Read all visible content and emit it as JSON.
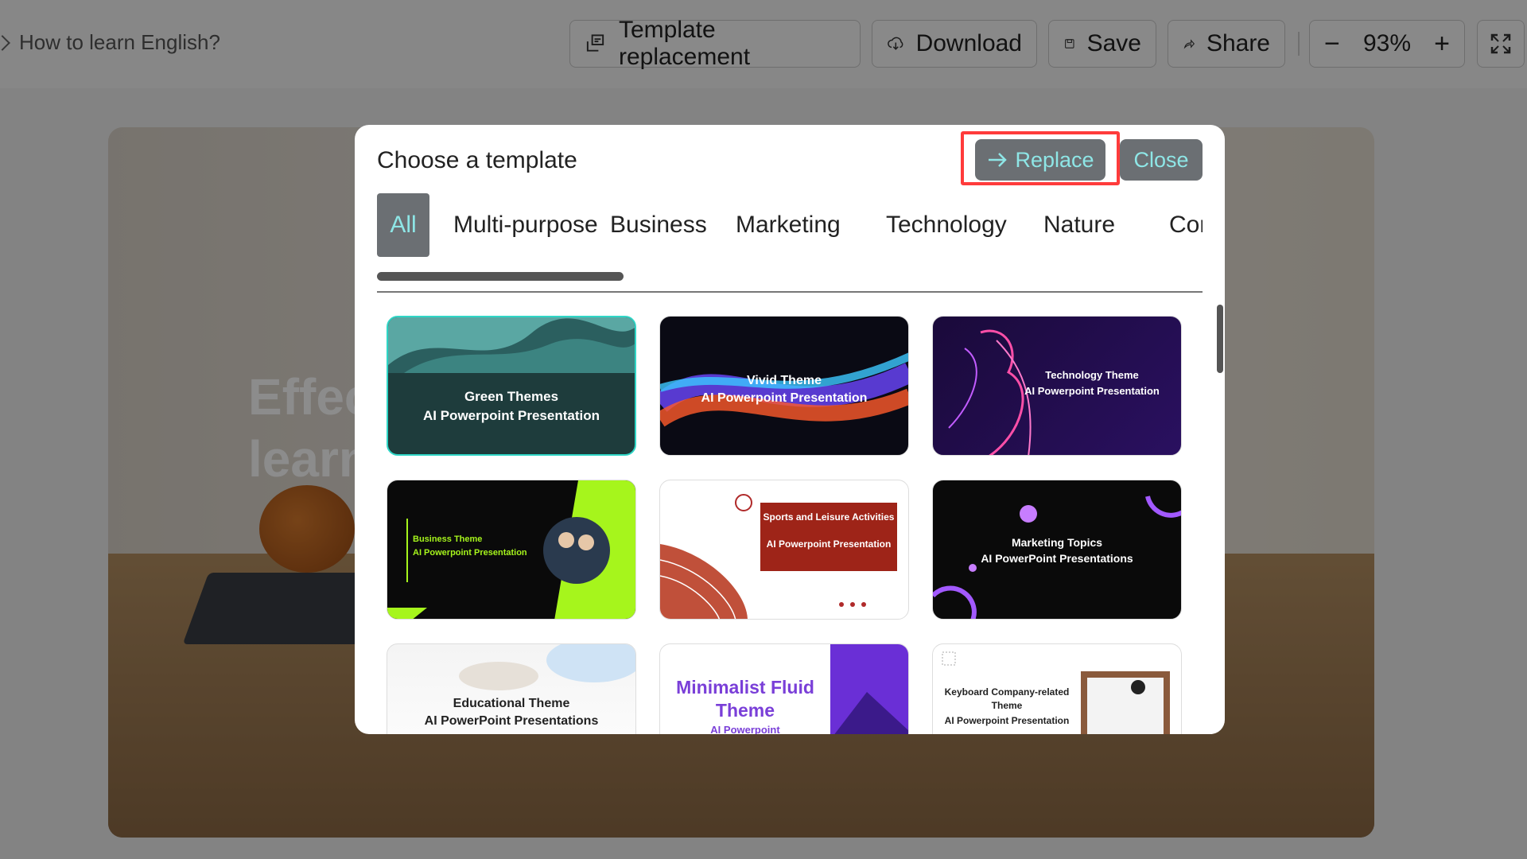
{
  "breadcrumb": {
    "label": "How to learn English?"
  },
  "toolbar": {
    "template_replacement": "Template replacement",
    "download": "Download",
    "save": "Save",
    "share": "Share",
    "zoom_out": "−",
    "zoom_level": "93%",
    "zoom_in": "+"
  },
  "slide": {
    "title": "Effective ways to learn English"
  },
  "modal": {
    "title": "Choose a template",
    "replace_label": "Replace",
    "close_label": "Close",
    "tabs": [
      "All",
      "Multi-purpose",
      "Business",
      "Marketing",
      "Technology",
      "Nature",
      "Cor"
    ],
    "templates": [
      {
        "line1": "Green Themes",
        "line2": "AI Powerpoint Presentation"
      },
      {
        "line1": "Vivid Theme",
        "line2": "AI Powerpoint Presentation"
      },
      {
        "line1": "Technology Theme",
        "line2": "AI Powerpoint Presentation"
      },
      {
        "line1": "Business Theme",
        "line2": "AI Powerpoint Presentation"
      },
      {
        "line1": "Sports and Leisure Activities",
        "line2": "AI Powerpoint Presentation"
      },
      {
        "line1": "Marketing Topics",
        "line2": "AI PowerPoint Presentations"
      },
      {
        "line1": "Educational Theme",
        "line2": "AI PowerPoint Presentations"
      },
      {
        "line1": "Minimalist Fluid Theme",
        "line2": "AI Powerpoint"
      },
      {
        "line1": "Keyboard Company-related Theme",
        "line2": "AI Powerpoint Presentation"
      }
    ]
  },
  "colors": {
    "accent_text": "#8ee6e6",
    "button_bg": "#6b6f73",
    "highlight": "#ff3b3b"
  }
}
